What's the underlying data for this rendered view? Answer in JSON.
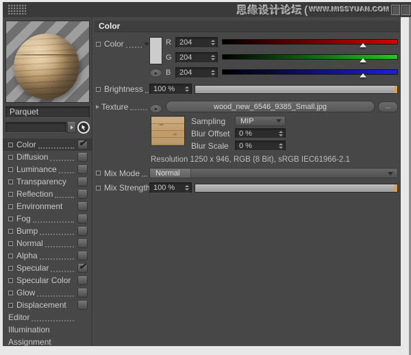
{
  "titlebar": {
    "watermark_cn": "思缘设计论坛",
    "watermark_bracket": "(",
    "watermark_url": "WWW.MISSYUAN.COM"
  },
  "icons": {
    "check": "✔"
  },
  "left_panel": {
    "material_name": "Parquet",
    "shader_field_value": "",
    "channels": [
      {
        "label": "Color",
        "dots": true,
        "checkbox": true,
        "checked": true,
        "selected": true
      },
      {
        "label": "Diffusion",
        "dots": true,
        "checkbox": true,
        "checked": false,
        "selected": false
      },
      {
        "label": "Luminance",
        "dots": true,
        "checkbox": true,
        "checked": false,
        "selected": false
      },
      {
        "label": "Transparency",
        "dots": false,
        "checkbox": true,
        "checked": false,
        "selected": false
      },
      {
        "label": "Reflection",
        "dots": true,
        "checkbox": true,
        "checked": false,
        "selected": false
      },
      {
        "label": "Environment",
        "dots": false,
        "checkbox": true,
        "checked": false,
        "selected": false
      },
      {
        "label": "Fog",
        "dots": true,
        "checkbox": true,
        "checked": false,
        "selected": false
      },
      {
        "label": "Bump",
        "dots": true,
        "checkbox": true,
        "checked": false,
        "selected": false
      },
      {
        "label": "Normal",
        "dots": true,
        "checkbox": true,
        "checked": false,
        "selected": false
      },
      {
        "label": "Alpha",
        "dots": true,
        "checkbox": true,
        "checked": false,
        "selected": false
      },
      {
        "label": "Specular",
        "dots": true,
        "checkbox": true,
        "checked": true,
        "selected": false
      },
      {
        "label": "Specular Color",
        "dots": false,
        "checkbox": true,
        "checked": false,
        "selected": false
      },
      {
        "label": "Glow",
        "dots": true,
        "checkbox": true,
        "checked": false,
        "selected": false
      },
      {
        "label": "Displacement",
        "dots": false,
        "checkbox": true,
        "checked": false,
        "selected": false
      },
      {
        "label": "Editor",
        "dots": true,
        "checkbox": false,
        "checked": false,
        "selected": false
      },
      {
        "label": "Illumination",
        "dots": false,
        "checkbox": false,
        "checked": false,
        "selected": false
      },
      {
        "label": "Assignment",
        "dots": false,
        "checkbox": false,
        "checked": false,
        "selected": false
      }
    ]
  },
  "color_tab": {
    "section_title": "Color",
    "color_label": "Color",
    "swatch_color": "#cccccc",
    "rgb": [
      {
        "channel": "R",
        "value": "204",
        "max_color": "#d80000",
        "percent": 80
      },
      {
        "channel": "G",
        "value": "204",
        "max_color": "#21c821",
        "percent": 80
      },
      {
        "channel": "B",
        "value": "204",
        "max_color": "#1d1de0",
        "percent": 80
      }
    ],
    "brightness": {
      "label": "Brightness",
      "value": "100 %",
      "percent": 100
    },
    "texture": {
      "label": "Texture",
      "file": "wood_new_6546_9385_Small.jpg",
      "browse": "..."
    },
    "sampling": {
      "label": "Sampling",
      "value": "MIP"
    },
    "blur_offset": {
      "label": "Blur Offset",
      "value": "0 %"
    },
    "blur_scale": {
      "label": "Blur Scale",
      "value": "0 %"
    },
    "resolution": "Resolution 1250 x 946, RGB (8 Bit), sRGB IEC61966-2.1",
    "mix_mode": {
      "label": "Mix Mode",
      "value": "Normal"
    },
    "mix_strength": {
      "label": "Mix Strength",
      "value": "100 %",
      "percent": 100
    }
  },
  "colors": {
    "accent_orange": "#e79b3c",
    "panel_bg": "#474747",
    "titlebar_bg": "#3a3a3a"
  }
}
